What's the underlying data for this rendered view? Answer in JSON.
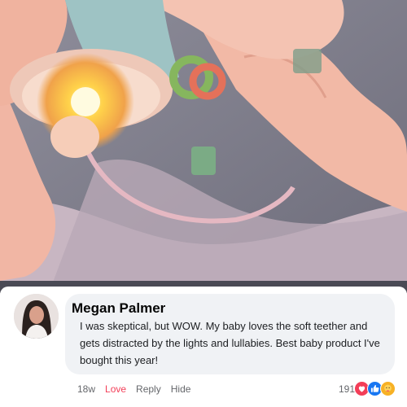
{
  "comment": {
    "author": "Megan Palmer",
    "text": "I was skeptical, but WOW. My baby loves the soft teether and gets distracted by the lights and lullabies. Best baby product I've bought this year!",
    "time": "18w",
    "love_label": "Love",
    "reply_label": "Reply",
    "hide_label": "Hide",
    "reaction_count": "191",
    "reactions": [
      "love-icon",
      "like-icon",
      "care-icon"
    ]
  },
  "colors": {
    "love": "#f33e58",
    "like": "#1877f2",
    "care": "#f7b125",
    "bubble": "#f0f2f5",
    "meta": "#65676b"
  }
}
